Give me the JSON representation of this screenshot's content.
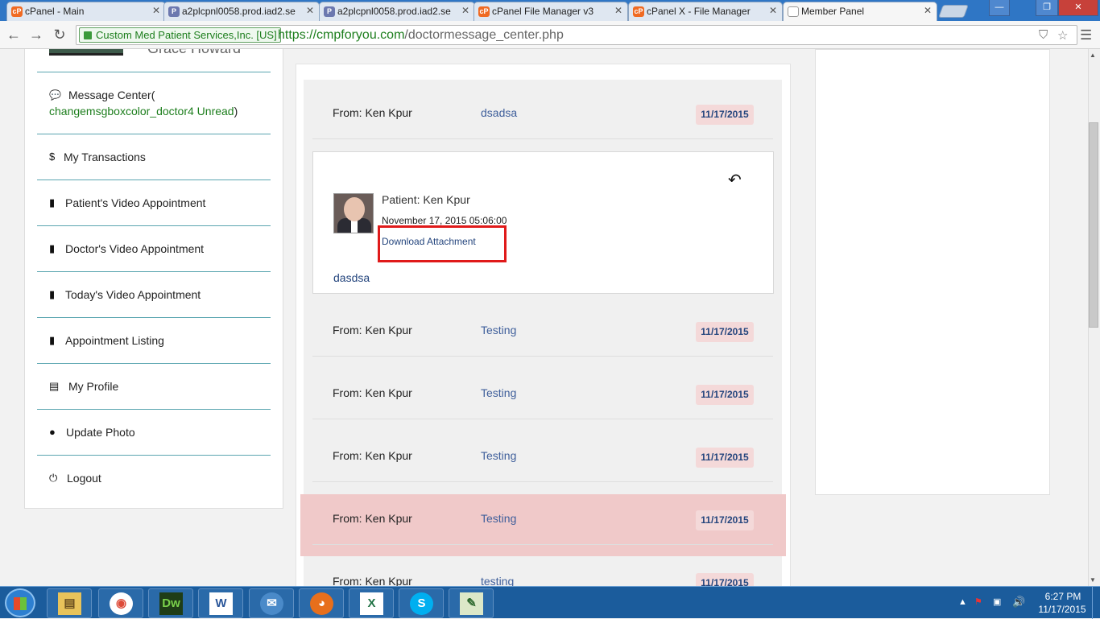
{
  "browser": {
    "tabs": [
      {
        "title": "cPanel - Main",
        "icon": "cpanel-icon"
      },
      {
        "title": "a2plcpnl0058.prod.iad2.se",
        "icon": "phpmyadmin-icon"
      },
      {
        "title": "a2plcpnl0058.prod.iad2.se",
        "icon": "phpmyadmin-icon"
      },
      {
        "title": "cPanel File Manager v3",
        "icon": "cpanel-icon"
      },
      {
        "title": "cPanel X - File Manager",
        "icon": "cpanel-icon"
      },
      {
        "title": "Member Panel",
        "icon": "page-icon"
      }
    ],
    "security_label": "Custom Med Patient Services,Inc. [US]",
    "url_domain": "https://cmpforyou.com",
    "url_path": "/doctormessage_center.php"
  },
  "user": {
    "name_partial": "Grace Howard"
  },
  "sidebar": {
    "message_center_label": "Message Center(",
    "message_center_unread": "changemsgboxcolor_doctor4 Unread",
    "message_center_close": ")",
    "items": [
      {
        "label": "My Transactions",
        "icon": "dollar-icon"
      },
      {
        "label": "Patient's Video Appointment",
        "icon": "bookmark-icon"
      },
      {
        "label": "Doctor's Video Appointment",
        "icon": "bookmark-icon"
      },
      {
        "label": "Today's Video Appointment",
        "icon": "bookmark-icon"
      },
      {
        "label": "Appointment Listing",
        "icon": "bookmark-icon"
      },
      {
        "label": "My Profile",
        "icon": "id-card-icon"
      },
      {
        "label": "Update Photo",
        "icon": "user-icon"
      },
      {
        "label": "Logout",
        "icon": "power-icon"
      }
    ]
  },
  "messages": [
    {
      "from": "From: Ken Kpur",
      "subject": "dsadsa",
      "date": "11/17/2015"
    },
    {
      "from": "From: Ken Kpur",
      "subject": "Testing",
      "date": "11/17/2015"
    },
    {
      "from": "From: Ken Kpur",
      "subject": "Testing",
      "date": "11/17/2015"
    },
    {
      "from": "From: Ken Kpur",
      "subject": "Testing",
      "date": "11/17/2015"
    },
    {
      "from": "From: Ken Kpur",
      "subject": "Testing",
      "date": "11/17/2015"
    },
    {
      "from": "From: Ken Kpur",
      "subject": "testing",
      "date": "11/17/2015"
    }
  ],
  "detail": {
    "patient": "Patient: Ken Kpur",
    "datetime": "November 17, 2015 05:06:00",
    "download_label": "Download Attachment",
    "body": "dasdsa"
  },
  "taskbar": {
    "apps": [
      {
        "name": "file-explorer-icon",
        "glyph": "▤"
      },
      {
        "name": "chrome-icon",
        "glyph": "◉"
      },
      {
        "name": "dreamweaver-icon",
        "glyph": "Dw"
      },
      {
        "name": "word-icon",
        "glyph": "W"
      },
      {
        "name": "thunderbird-icon",
        "glyph": "✉"
      },
      {
        "name": "firefox-icon",
        "glyph": "◕"
      },
      {
        "name": "excel-icon",
        "glyph": "X"
      },
      {
        "name": "skype-icon",
        "glyph": "S"
      },
      {
        "name": "notepad-icon",
        "glyph": "✎"
      }
    ],
    "time": "6:27 PM",
    "date": "11/17/2015"
  },
  "colors": {
    "accent_link": "#24457d",
    "date_badge_bg": "#f4d9d9",
    "highlight_row": "#f0c9c9",
    "annotation_red": "#e01a1a",
    "sidebar_divider": "#5aa5b0"
  }
}
